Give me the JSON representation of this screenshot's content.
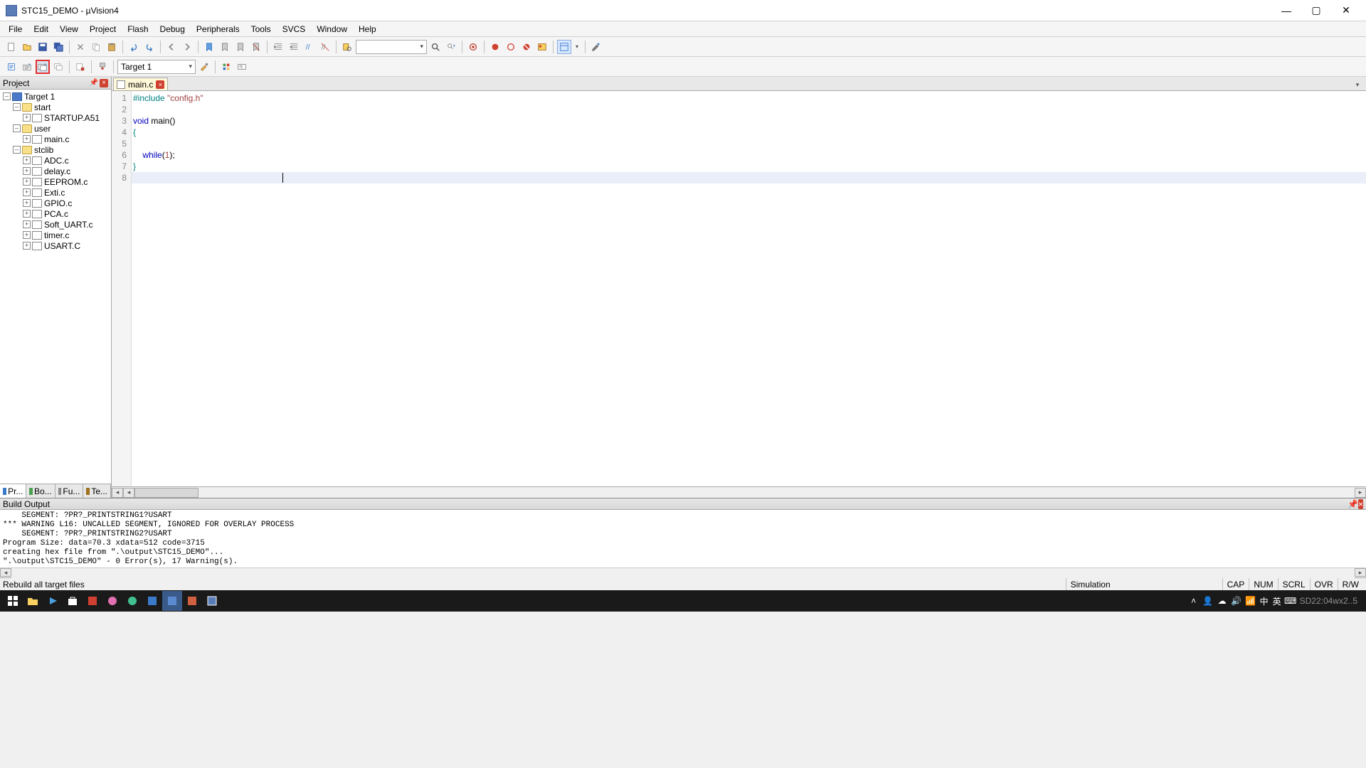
{
  "window": {
    "title": "STC15_DEMO  - µVision4"
  },
  "menus": [
    "File",
    "Edit",
    "View",
    "Project",
    "Flash",
    "Debug",
    "Peripherals",
    "Tools",
    "SVCS",
    "Window",
    "Help"
  ],
  "toolbar2": {
    "target_combo": "Target 1"
  },
  "project_panel": {
    "title": "Project",
    "root": "Target 1",
    "groups": [
      {
        "name": "start",
        "files": [
          "STARTUP.A51"
        ]
      },
      {
        "name": "user",
        "files": [
          "main.c"
        ]
      },
      {
        "name": "stclib",
        "files": [
          "ADC.c",
          "delay.c",
          "EEPROM.c",
          "Exti.c",
          "GPIO.c",
          "PCA.c",
          "Soft_UART.c",
          "timer.c",
          "USART.C"
        ]
      }
    ],
    "bottom_tabs": [
      "Pr...",
      "Bo...",
      "Fu...",
      "Te..."
    ]
  },
  "editor": {
    "tab_label": "main.c",
    "lines": [
      {
        "n": 1,
        "segs": [
          {
            "t": "#include ",
            "c": "pre"
          },
          {
            "t": "\"config.h\"",
            "c": "str"
          }
        ]
      },
      {
        "n": 2,
        "segs": []
      },
      {
        "n": 3,
        "segs": [
          {
            "t": "void",
            "c": "kw"
          },
          {
            "t": " main()",
            "c": ""
          }
        ]
      },
      {
        "n": 4,
        "segs": [
          {
            "t": "{",
            "c": "brace"
          }
        ]
      },
      {
        "n": 5,
        "segs": []
      },
      {
        "n": 6,
        "segs": [
          {
            "t": "    ",
            "c": ""
          },
          {
            "t": "while",
            "c": "kw"
          },
          {
            "t": "(",
            "c": ""
          },
          {
            "t": "1",
            "c": "num"
          },
          {
            "t": ");",
            "c": ""
          }
        ]
      },
      {
        "n": 7,
        "segs": [
          {
            "t": "}",
            "c": "brace"
          }
        ]
      },
      {
        "n": 8,
        "segs": []
      }
    ],
    "current_line": 8
  },
  "build_output": {
    "title": "Build Output",
    "lines": [
      "    SEGMENT: ?PR?_PRINTSTRING1?USART",
      "*** WARNING L16: UNCALLED SEGMENT, IGNORED FOR OVERLAY PROCESS",
      "    SEGMENT: ?PR?_PRINTSTRING2?USART",
      "Program Size: data=70.3 xdata=512 code=3715",
      "creating hex file from \".\\output\\STC15_DEMO\"...",
      "\".\\output\\STC15_DEMO\" - 0 Error(s), 17 Warning(s)."
    ]
  },
  "statusbar": {
    "left": "Rebuild all target files",
    "mode": "Simulation",
    "indicators": [
      "CAP",
      "NUM",
      "SCRL",
      "OVR",
      "R/W"
    ]
  },
  "taskbar": {
    "time": "22:04",
    "ime": "英",
    "ime2": "中"
  }
}
